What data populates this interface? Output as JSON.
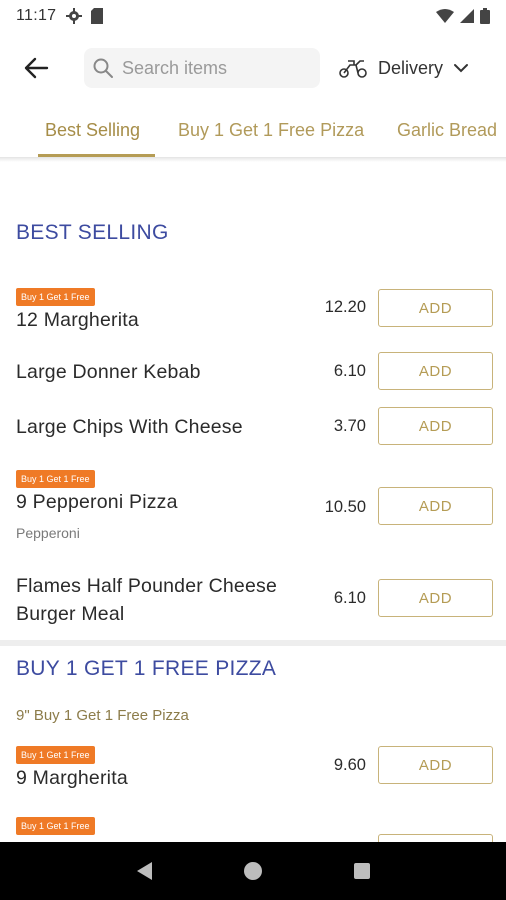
{
  "status_bar": {
    "time": "11:17"
  },
  "search": {
    "placeholder": "Search items"
  },
  "delivery": {
    "label": "Delivery"
  },
  "tabs": [
    {
      "label": "Best Selling",
      "active": true
    },
    {
      "label": "Buy 1 Get 1 Free Pizza",
      "active": false
    },
    {
      "label": "Garlic Bread",
      "active": false
    }
  ],
  "sections": [
    {
      "title": "BEST SELLING",
      "items": [
        {
          "badge": "Buy 1 Get 1 Free",
          "name": "12 Margherita",
          "price": "12.20",
          "add_label": "ADD"
        },
        {
          "name": "Large Donner Kebab",
          "price": "6.10",
          "add_label": "ADD"
        },
        {
          "name": "Large Chips With Cheese",
          "price": "3.70",
          "add_label": "ADD"
        },
        {
          "badge": "Buy 1 Get 1 Free",
          "name": "9 Pepperoni Pizza",
          "desc": "Pepperoni",
          "price": "10.50",
          "add_label": "ADD"
        },
        {
          "name_line1": "Flames Half Pounder Cheese",
          "name_line2": "Burger Meal",
          "price": "6.10",
          "add_label": "ADD"
        }
      ]
    },
    {
      "title": "BUY 1 GET 1 FREE PIZZA",
      "subtitle": "9\" Buy 1 Get 1 Free Pizza",
      "items": [
        {
          "badge": "Buy 1 Get 1 Free",
          "name": "9 Margherita",
          "price": "9.60",
          "add_label": "ADD"
        },
        {
          "badge": "Buy 1 Get 1 Free"
        }
      ]
    }
  ],
  "colors": {
    "accent": "#b59c55",
    "section_title": "#3d4ba0",
    "badge": "#ef7a26"
  }
}
